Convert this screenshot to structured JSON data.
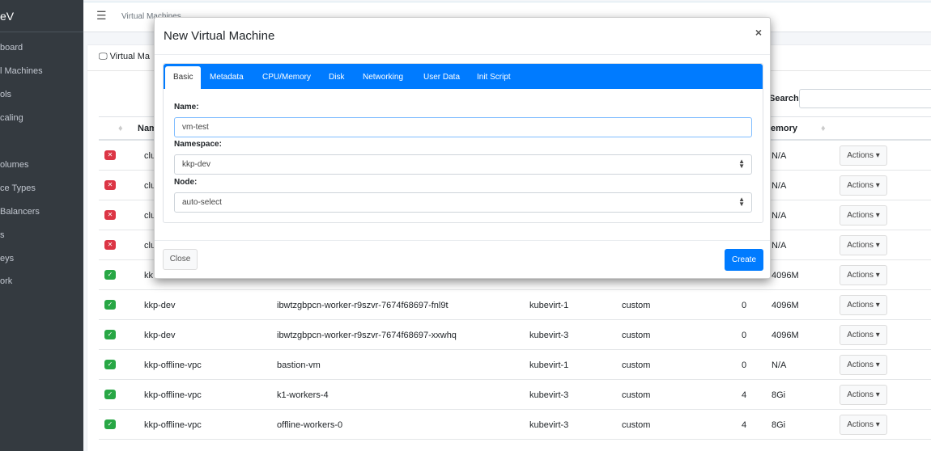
{
  "sidebar": {
    "brand": "eV",
    "items": [
      "board",
      "l Machines",
      "ols",
      "caling",
      "olumes",
      "ce Types",
      "Balancers",
      "s",
      "eys",
      "ork"
    ]
  },
  "topbar": {
    "breadcrumb": "Virtual Machines"
  },
  "card": {
    "title": "Virtual Ma",
    "search_label": "Search:",
    "search_value": ""
  },
  "table": {
    "headers": {
      "name": "Nam",
      "memory": "emory"
    },
    "rows": [
      {
        "status": "error",
        "namespace": "clu",
        "name": "",
        "node": "",
        "type": "",
        "cpu": "",
        "memory": "N/A",
        "action": "Actions"
      },
      {
        "status": "error",
        "namespace": "clu",
        "name": "",
        "node": "",
        "type": "",
        "cpu": "",
        "memory": "N/A",
        "action": "Actions"
      },
      {
        "status": "error",
        "namespace": "clu",
        "name": "",
        "node": "",
        "type": "",
        "cpu": "",
        "memory": "N/A",
        "action": "Actions"
      },
      {
        "status": "error",
        "namespace": "clu",
        "name": "",
        "node": "",
        "type": "",
        "cpu": "",
        "memory": "N/A",
        "action": "Actions"
      },
      {
        "status": "ok",
        "namespace": "kk",
        "name": "",
        "node": "",
        "type": "",
        "cpu": "",
        "memory": "4096M",
        "action": "Actions"
      },
      {
        "status": "ok",
        "namespace": "kkp-dev",
        "name": "ibwtzgbpcn-worker-r9szvr-7674f68697-fnl9t",
        "node": "kubevirt-1",
        "type": "custom",
        "cpu": "0",
        "memory": "4096M",
        "action": "Actions"
      },
      {
        "status": "ok",
        "namespace": "kkp-dev",
        "name": "ibwtzgbpcn-worker-r9szvr-7674f68697-xxwhq",
        "node": "kubevirt-3",
        "type": "custom",
        "cpu": "0",
        "memory": "4096M",
        "action": "Actions"
      },
      {
        "status": "ok",
        "namespace": "kkp-offline-vpc",
        "name": "bastion-vm",
        "node": "kubevirt-1",
        "type": "custom",
        "cpu": "0",
        "memory": "N/A",
        "action": "Actions"
      },
      {
        "status": "ok",
        "namespace": "kkp-offline-vpc",
        "name": "k1-workers-4",
        "node": "kubevirt-3",
        "type": "custom",
        "cpu": "4",
        "memory": "8Gi",
        "action": "Actions"
      },
      {
        "status": "ok",
        "namespace": "kkp-offline-vpc",
        "name": "offline-workers-0",
        "node": "kubevirt-3",
        "type": "custom",
        "cpu": "4",
        "memory": "8Gi",
        "action": "Actions"
      }
    ]
  },
  "modal": {
    "title": "New Virtual Machine",
    "close_icon": "×",
    "tabs": [
      "Basic",
      "Metadata",
      "CPU/Memory",
      "Disk",
      "Networking",
      "User Data",
      "Init Script"
    ],
    "active_tab": "Basic",
    "fields": {
      "name_label": "Name:",
      "name_value": "vm-test",
      "namespace_label": "Namespace:",
      "namespace_value": "kkp-dev",
      "node_label": "Node:",
      "node_value": "auto-select"
    },
    "close_button": "Close",
    "create_button": "Create"
  },
  "colors": {
    "primary": "#007bff",
    "sidebar": "#343a40",
    "error": "#dc3545",
    "success": "#28a745"
  }
}
